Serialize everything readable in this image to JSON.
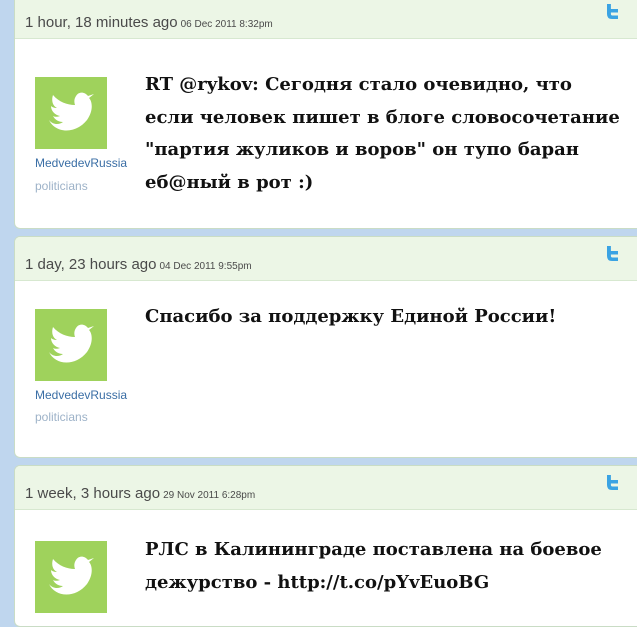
{
  "tweets": [
    {
      "ago": "1 hour, 18 minutes ago",
      "timestamp": "06 Dec 2011 8:32pm",
      "username": "MedvedevRussia",
      "category": "politicians",
      "text": "RT @rykov: Сегодня стало очевидно, что если человек пишет в блоге словосочетание \"партия жуликов и воров\" он тупо баран еб@ный в рот :)"
    },
    {
      "ago": "1 day, 23 hours ago",
      "timestamp": "04 Dec 2011 9:55pm",
      "username": "MedvedevRussia",
      "category": "politicians",
      "text": "Спасибо за поддержку Единой России!"
    },
    {
      "ago": "1 week, 3 hours ago",
      "timestamp": "29 Nov 2011 6:28pm",
      "text": "РЛС в Калининграде поставлена на боевое дежурство - http://t.co/pYvEuoBG"
    }
  ],
  "icons": {
    "twitter": "twitter-bird-icon",
    "avatar": "twitter-bird-avatar"
  },
  "colors": {
    "header_bg": "#ecf6e6",
    "avatar_bg": "#9fd25c",
    "username": "#3a6ea5",
    "page_bg": "#bfd6ee"
  }
}
